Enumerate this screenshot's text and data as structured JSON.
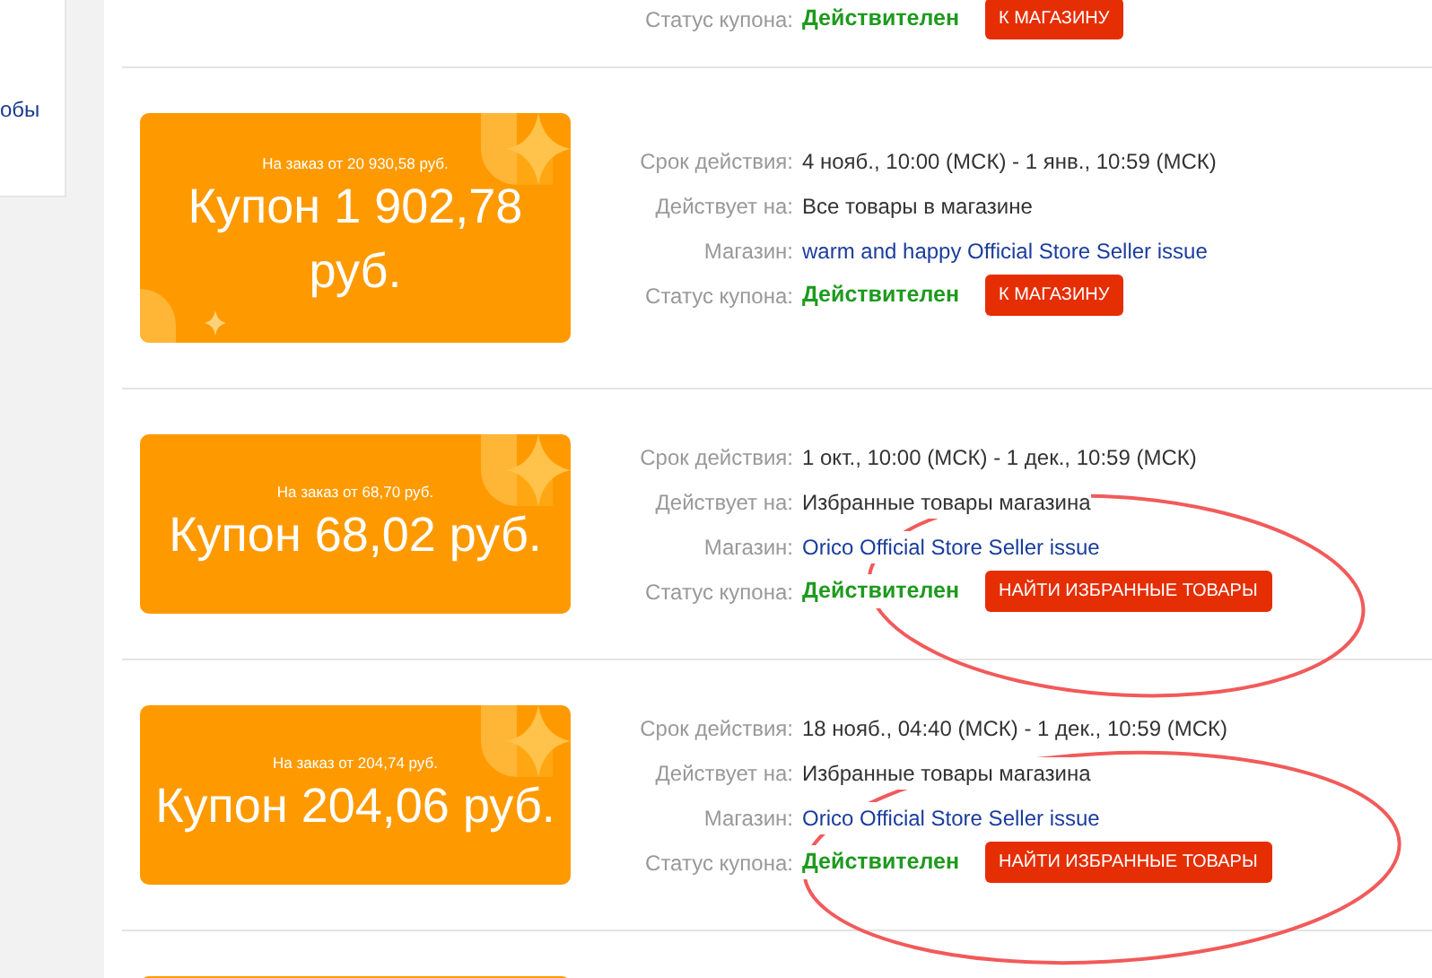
{
  "sidebar": {
    "link": "обы"
  },
  "coupons": [
    {
      "kind": "cut_top",
      "status_label": "Статус купона:",
      "status": "Действителен",
      "button": "К МАГАЗИНУ"
    },
    {
      "kind": "full",
      "min_order": "На заказ от 20 930,58 руб.",
      "amount": "Купон 1 902,78 руб.",
      "corner_decoration": true,
      "validity_label": "Срок действия:",
      "validity": "4 нояб., 10:00 (МСК) - 1 янв., 10:59 (МСК)",
      "applies_label": "Действует на:",
      "applies_to": "Все товары в магазине",
      "store_label": "Магазин:",
      "store": "warm and happy Official Store Seller issue",
      "status_label": "Статус купона:",
      "status": "Действителен",
      "button": "К МАГАЗИНУ"
    },
    {
      "kind": "full",
      "min_order": "На заказ от 68,70 руб.",
      "amount": "Купон 68,02 руб.",
      "corner_decoration": false,
      "validity_label": "Срок действия:",
      "validity": "1 окт., 10:00 (МСК) - 1 дек., 10:59 (МСК)",
      "applies_label": "Действует на:",
      "applies_to": "Избранные товары магазина",
      "store_label": "Магазин:",
      "store": "Orico Official Store Seller issue",
      "status_label": "Статус купона:",
      "status": "Действителен",
      "button": "НАЙТИ ИЗБРАННЫЕ ТОВАРЫ"
    },
    {
      "kind": "full",
      "min_order": "На заказ от 204,74 руб.",
      "amount": "Купон 204,06 руб.",
      "corner_decoration": false,
      "validity_label": "Срок действия:",
      "validity": "18 нояб., 04:40 (МСК) - 1 дек., 10:59 (МСК)",
      "applies_label": "Действует на:",
      "applies_to": "Избранные товары магазина",
      "store_label": "Магазин:",
      "store": "Orico Official Store Seller issue",
      "status_label": "Статус купона:",
      "status": "Действителен",
      "button": "НАЙТИ ИЗБРАННЫЕ ТОВАРЫ"
    },
    {
      "kind": "cut_bottom"
    }
  ]
}
